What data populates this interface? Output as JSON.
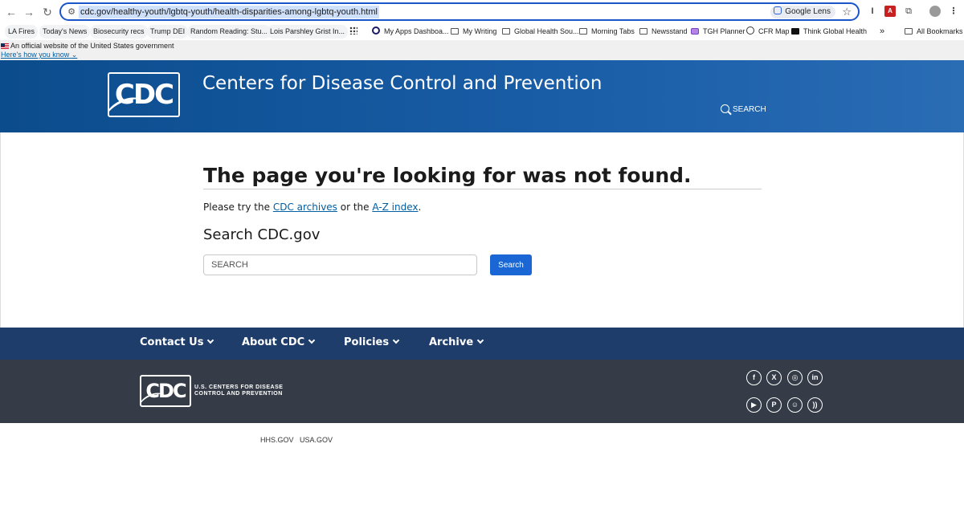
{
  "browser": {
    "url": "cdc.gov/healthy-youth/lgbtq-youth/health-disparities-among-lgbtq-youth.html",
    "lens_label": "Google Lens",
    "bookmarks": [
      {
        "label": "LA Fires"
      },
      {
        "label": "Today's News"
      },
      {
        "label": "Biosecurity recs"
      },
      {
        "label": "Trump DEI"
      },
      {
        "label": "Random Reading: Stu..."
      },
      {
        "label": "Lois Parshley Grist In..."
      },
      {
        "label": "My Apps Dashboa..."
      },
      {
        "label": "My Writing"
      },
      {
        "label": "Global Health Sou..."
      },
      {
        "label": "Morning Tabs"
      },
      {
        "label": "Newsstand"
      },
      {
        "label": "TGH Planner"
      },
      {
        "label": "CFR Map"
      },
      {
        "label": "Think Global Health"
      }
    ],
    "overflow": "»",
    "all_bookmarks": "All Bookmarks"
  },
  "gov_banner": {
    "text": "An official website of the United States government",
    "link": "Here's how you know"
  },
  "header": {
    "logo_text": "CDC",
    "site_title": "Centers for Disease Control and Prevention",
    "search_label": "SEARCH"
  },
  "main": {
    "title": "The page you're looking for was not found.",
    "para_prefix": "Please try the ",
    "archives_link": "CDC archives",
    "para_middle": " or the ",
    "az_link": "A-Z index",
    "para_suffix": ".",
    "search_heading": "Search CDC.gov",
    "search_placeholder": "SEARCH",
    "search_button": "Search"
  },
  "footer": {
    "nav": [
      "Contact Us",
      "About CDC",
      "Policies",
      "Archive"
    ],
    "logo_text": "CDC",
    "org_line1": "U.S. CENTERS FOR DISEASE",
    "org_line2": "CONTROL AND PREVENTION",
    "social": [
      "facebook-icon",
      "x-icon",
      "instagram-icon",
      "linkedin-icon",
      "youtube-icon",
      "pinterest-icon",
      "snapchat-icon",
      "rss-icon"
    ],
    "links": [
      "HHS.GOV",
      "USA.GOV"
    ]
  }
}
